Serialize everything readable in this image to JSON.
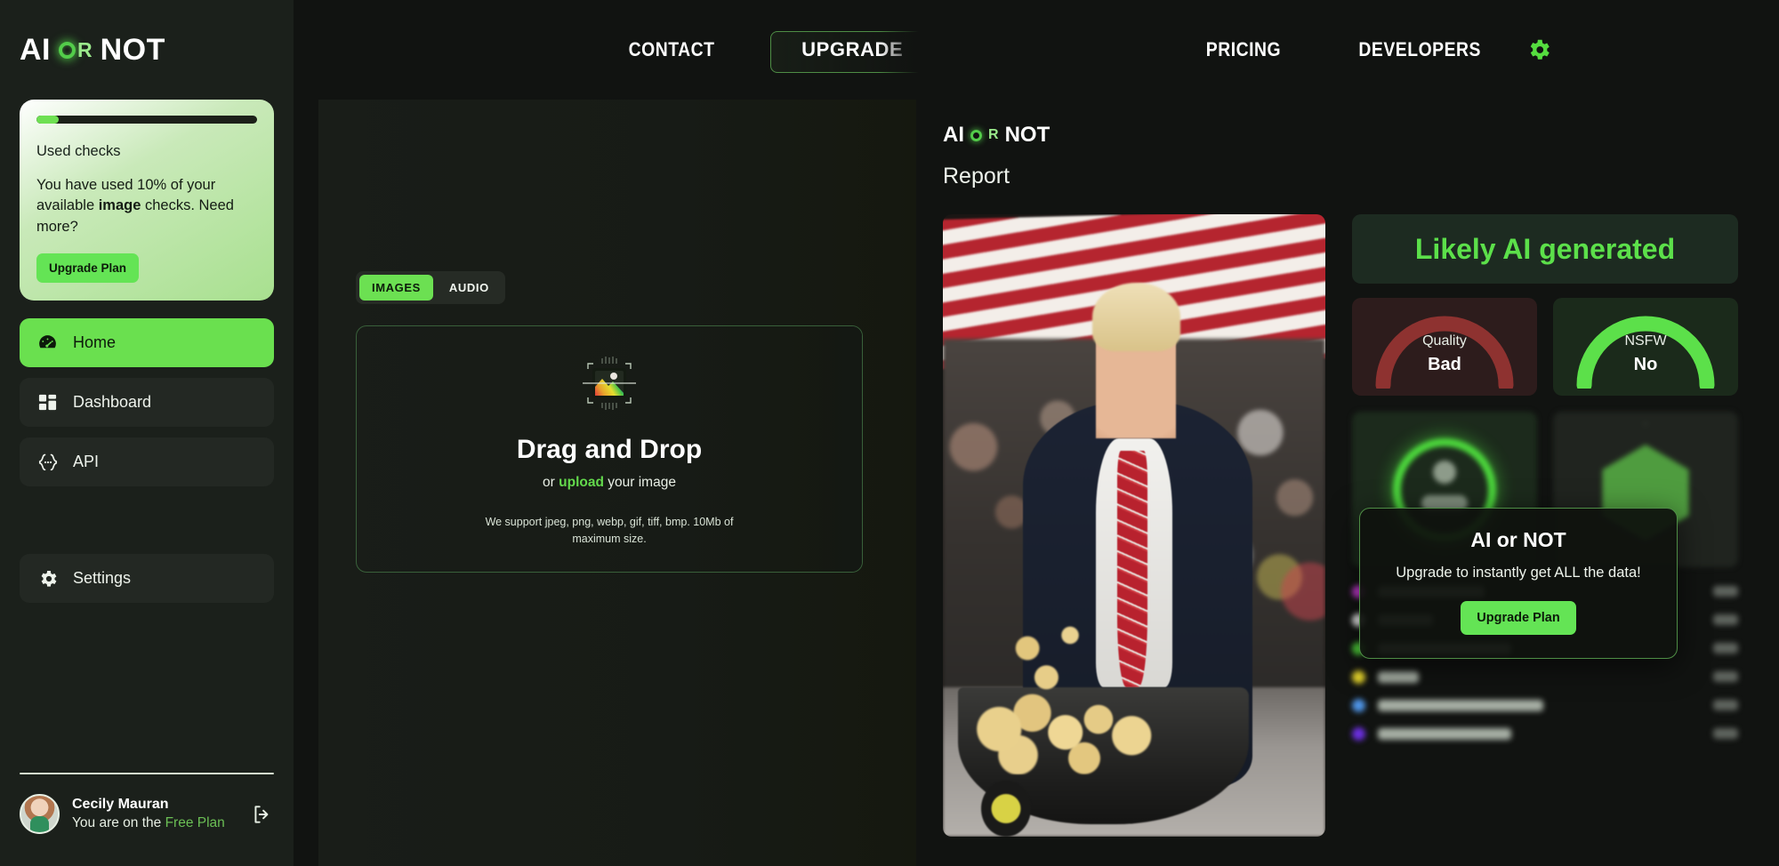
{
  "brand": {
    "ai": "AI",
    "or": "OR",
    "not": "NOT"
  },
  "sidebar": {
    "usage": {
      "progress_percent": 10,
      "title": "Used checks",
      "text_before": "You have used 10% of your available ",
      "text_bold": "image",
      "text_after": " checks. Need more?",
      "upgrade_label": "Upgrade Plan"
    },
    "items": [
      {
        "label": "Home",
        "icon": "speedometer-icon",
        "active": true
      },
      {
        "label": "Dashboard",
        "icon": "dashboard-grid-icon",
        "active": false
      },
      {
        "label": "API",
        "icon": "code-braces-icon",
        "active": false
      },
      {
        "label": "Settings",
        "icon": "gear-icon",
        "active": false
      }
    ],
    "user": {
      "name": "Cecily Mauran",
      "plan_prefix": "You are on the ",
      "plan_name": "Free Plan",
      "logout_icon": "logout-icon"
    }
  },
  "header": {
    "contact": "CONTACT",
    "upgrade": "UPGRADE",
    "pricing": "PRICING",
    "developers": "DEVELOPERS",
    "settings_icon": "gear-icon"
  },
  "upload": {
    "tabs": [
      {
        "label": "IMAGES",
        "active": true
      },
      {
        "label": "AUDIO",
        "active": false
      }
    ],
    "icon": "image-scan-icon",
    "title": "Drag and Drop",
    "sub_before": "or ",
    "sub_link": "upload",
    "sub_after": " your image",
    "note": "We support jpeg, png, webp, gif, tiff, bmp. 10Mb of maximum size."
  },
  "report": {
    "title": "Report",
    "analyzed_image_alt": "analyzed-image",
    "verdict": "Likely AI generated",
    "gauges": [
      {
        "name": "Quality",
        "value": "Bad",
        "status": "bad",
        "color": "#8e3230"
      },
      {
        "name": "NSFW",
        "value": "No",
        "status": "good",
        "color": "#5ce04a"
      }
    ],
    "locked_cards": [
      {
        "icon": "face-detect-ring-icon"
      },
      {
        "icon": "hexagon-radar-icon"
      }
    ],
    "legend_dots": [
      "#c93bd6",
      "#f2f2f2",
      "#4fd43a",
      "#e3d32c",
      "#4f95e8",
      "#6b2fe0"
    ],
    "overlay": {
      "title": "AI or NOT",
      "subtitle": "Upgrade to instantly get ALL the data!",
      "button": "Upgrade Plan"
    }
  },
  "colors": {
    "accent_green": "#6ae04f",
    "bright_green": "#5ce04a",
    "bad_red": "#8e3230",
    "sidebar_bg": "#1b201b",
    "page_bg": "#111311"
  }
}
